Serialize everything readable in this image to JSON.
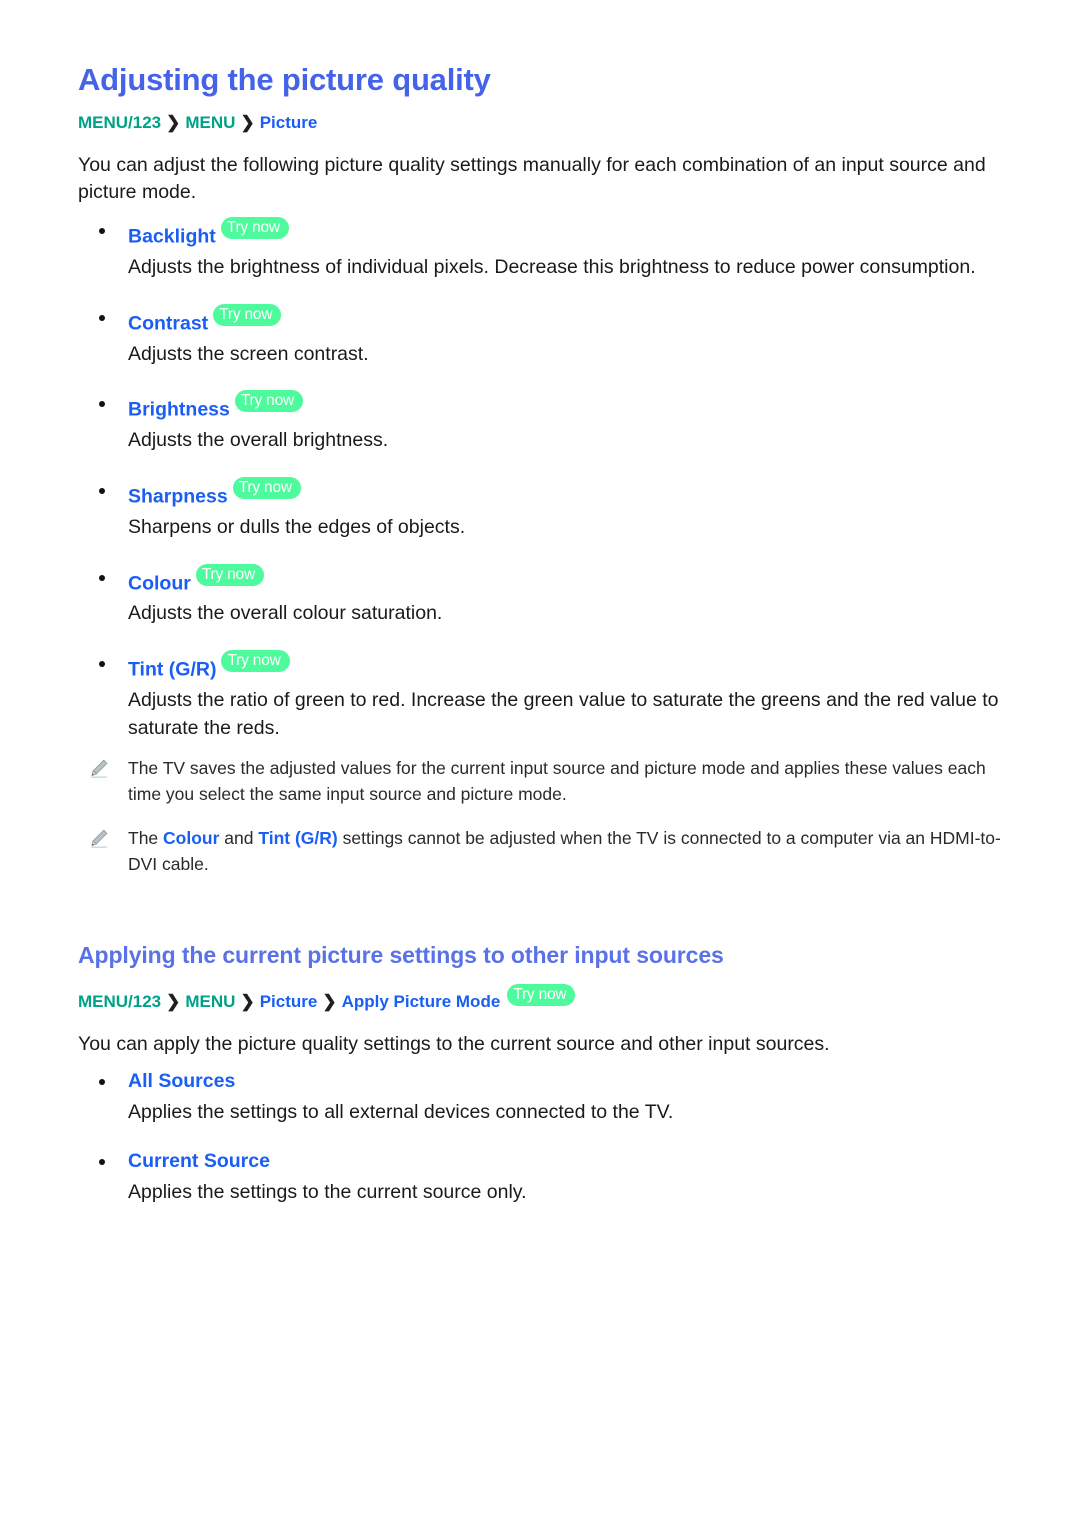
{
  "page": {
    "title": "Adjusting the picture quality",
    "background": "#ffffff",
    "heading_color": "#4563e8",
    "link_color": "#1a5ef5",
    "menu_color": "#00a287",
    "badge_color": "#4dfb9c",
    "badge_text_color": "#ffffff"
  },
  "breadcrumb_1": {
    "menu123": "MENU/123",
    "separator_1": "❯",
    "menu": "MENU",
    "separator_2": "❯",
    "picture": "Picture"
  },
  "intro": {
    "paragraph": "You can adjust the following picture quality settings manually for each combination of an input source and picture mode."
  },
  "badge": {
    "try_now": "Try now"
  },
  "settings": [
    {
      "label": "Backlight",
      "has_badge": true,
      "description": "Adjusts the brightness of individual pixels. Decrease this brightness to reduce power consumption."
    },
    {
      "label": "Contrast",
      "has_badge": true,
      "description": "Adjusts the screen contrast."
    },
    {
      "label": "Brightness",
      "has_badge": true,
      "description": "Adjusts the overall brightness."
    },
    {
      "label": "Sharpness",
      "has_badge": true,
      "description": "Sharpens or dulls the edges of objects."
    },
    {
      "label": "Colour",
      "has_badge": true,
      "description": "Adjusts the overall colour saturation."
    },
    {
      "label": "Tint (G/R)",
      "has_badge": true,
      "description": "Adjusts the ratio of green to red. Increase the green value to saturate the greens and the red value to saturate the reds."
    }
  ],
  "notes": [
    {
      "icon": "pencil-icon",
      "text": "The TV saves the adjusted values for the current input source and picture mode and applies these values each time you select the same input source and picture mode."
    },
    {
      "icon": "pencil-icon",
      "prefix": "The ",
      "link_1": "Colour",
      "middle": " and ",
      "link_2": "Tint (G/R)",
      "suffix": " settings cannot be adjusted when the TV is connected to a computer via an HDMI-to-DVI cable."
    }
  ],
  "section_2": {
    "title": "Applying the current picture settings to other input sources",
    "breadcrumb": {
      "menu123": "MENU/123",
      "separator_1": "❯",
      "menu": "MENU",
      "separator_2": "❯",
      "picture": "Picture",
      "separator_3": "❯",
      "apply_picture_mode": "Apply Picture Mode"
    },
    "paragraph": "You can apply the picture quality settings to the current source and other input sources.",
    "options": [
      {
        "label": "All Sources",
        "description": "Applies the settings to all external devices connected to the TV."
      },
      {
        "label": "Current Source",
        "description": "Applies the settings to the current source only."
      }
    ]
  }
}
